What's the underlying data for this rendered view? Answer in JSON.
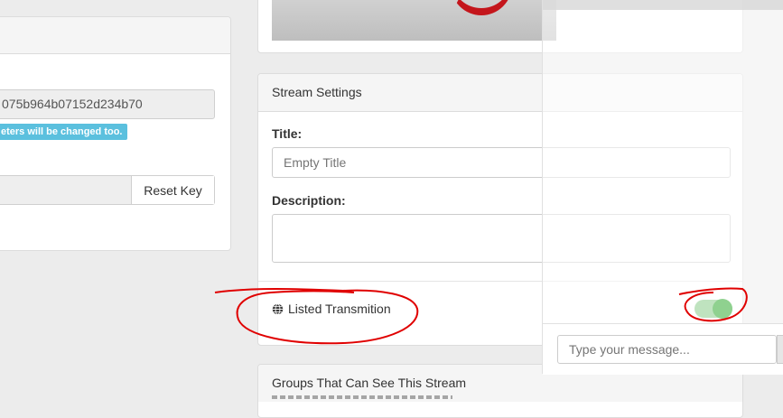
{
  "left_panel": {
    "stream_key": "075b964b07152d234b70",
    "info_badge": "eters will be changed too.",
    "reset_key_label": "Reset Key"
  },
  "stream_settings": {
    "heading": "Stream Settings",
    "title_label": "Title:",
    "title_placeholder": "Empty Title",
    "description_label": "Description:",
    "listed_label": "Listed Transmition",
    "listed_enabled": true
  },
  "groups": {
    "heading": "Groups That Can See This Stream"
  },
  "chat": {
    "message_placeholder": "Type your message..."
  },
  "colors": {
    "info_badge": "#5bc0de",
    "toggle_on": "#8fd18f",
    "annotation": "#e00000"
  }
}
